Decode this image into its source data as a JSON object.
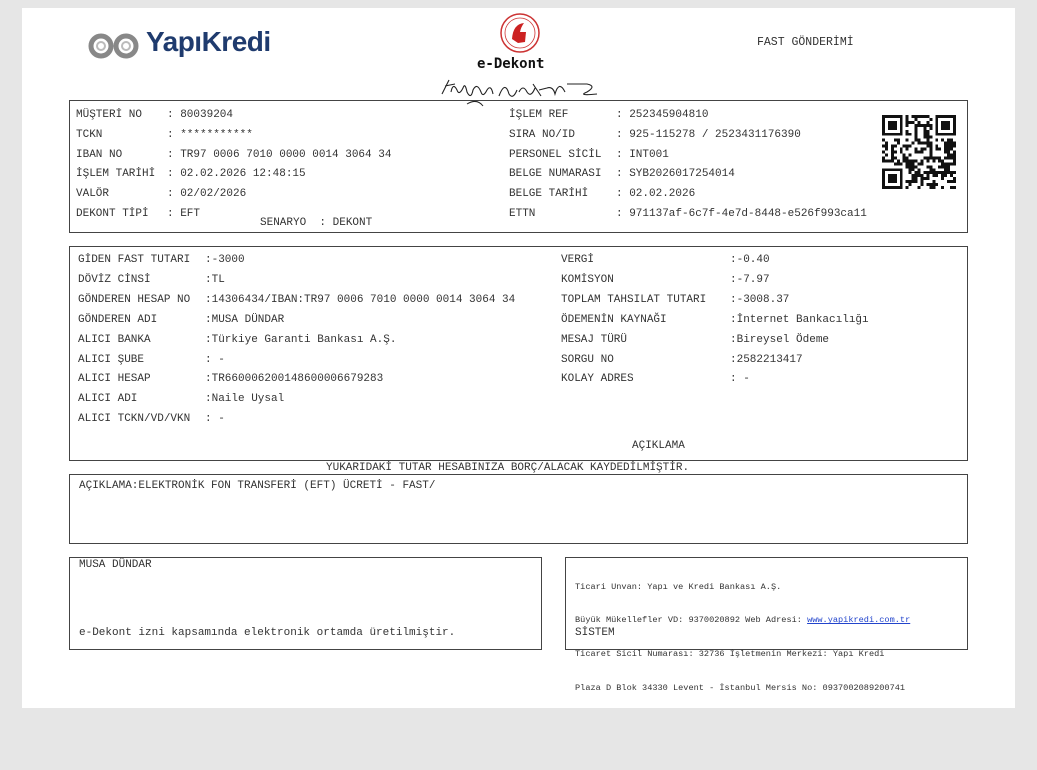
{
  "header": {
    "bank_logo": "YapıKredi",
    "doc_title": "e-Dekont",
    "transfer_type": "FAST GÖNDERİMİ"
  },
  "info_left": [
    {
      "label": "MÜŞTERİ NO",
      "value": ": 80039204"
    },
    {
      "label": "TCKN",
      "value": ": ***********"
    },
    {
      "label": "IBAN NO",
      "value": ": TR97 0006 7010 0000 0014 3064 34"
    },
    {
      "label": "İŞLEM TARİHİ",
      "value": ": 02.02.2026 12:48:15"
    },
    {
      "label": "VALÖR",
      "value": ": 02/02/2026"
    },
    {
      "label": "DEKONT TİPİ",
      "value": ": EFT"
    }
  ],
  "scenario": {
    "label": "SENARYO",
    "value": ": DEKONT"
  },
  "info_right": [
    {
      "label": "İŞLEM REF",
      "value": ": 252345904810"
    },
    {
      "label": "SIRA NO/ID",
      "value": ": 925-115278 / 2523431176390"
    },
    {
      "label": "PERSONEL SİCİL",
      "value": ": INT001"
    },
    {
      "label": "BELGE NUMARASI",
      "value": ": SYB2026017254014"
    },
    {
      "label": "BELGE TARİHİ",
      "value": ": 02.02.2026"
    },
    {
      "label": "ETTN",
      "value": ": 971137af-6c7f-4e7d-8448-e526f993ca11"
    }
  ],
  "details_left": [
    {
      "label": "GİDEN FAST TUTARI",
      "value": ":-3000"
    },
    {
      "label": "DÖVİZ CİNSİ",
      "value": ":TL"
    },
    {
      "label": "GÖNDEREN HESAP NO",
      "value": ":14306434/IBAN:TR97 0006 7010 0000 0014 3064 34"
    },
    {
      "label": "GÖNDEREN ADI",
      "value": ":MUSA DÜNDAR"
    },
    {
      "label": "ALICI BANKA",
      "value": ":Türkiye Garanti Bankası A.Ş."
    },
    {
      "label": "ALICI ŞUBE",
      "value": ": -"
    },
    {
      "label": "ALICI HESAP",
      "value": ":TR660006200148600006679283"
    },
    {
      "label": "ALICI ADI",
      "value": ":Naile Uysal"
    },
    {
      "label": "ALICI TCKN/VD/VKN",
      "value": ": -"
    }
  ],
  "details_right": [
    {
      "label": "VERGİ",
      "value": ":-0.40"
    },
    {
      "label": "KOMİSYON",
      "value": ":-7.97"
    },
    {
      "label": "TOPLAM TAHSILAT TUTARI",
      "value": ":-3008.37"
    },
    {
      "label": "ÖDEMENİN KAYNAĞI",
      "value": ":İnternet Bankacılığı"
    },
    {
      "label": "MESAJ TÜRÜ",
      "value": ":Bireysel Ödeme"
    },
    {
      "label": "SORGU NO",
      "value": ":2582213417"
    },
    {
      "label": "KOLAY ADRES",
      "value": ": -"
    }
  ],
  "aciklama_header": "AÇIKLAMA",
  "notice": "YUKARIDAKİ TUTAR HESABINIZA BORÇ/ALACAK KAYDEDİLMİŞTİR.",
  "description": "AÇIKLAMA:ELEKTRONİK FON TRANSFERİ (EFT) ÜCRETİ - FAST/",
  "customer_box": {
    "name": "MUSA DÜNDAR",
    "note": "e-Dekont izni kapsamında elektronik ortamda üretilmiştir."
  },
  "bank_box": {
    "line1": "Ticari Unvan: Yapı ve Kredi Bankası A.Ş.",
    "line2_prefix": "Büyük Mükellefler VD: 9370020892 Web Adresi: ",
    "link": "www.yapikredi.com.tr",
    "line3": "Ticaret Sicil Numarası: 32736 İşletmenin Merkezi: Yapı Kredi",
    "line4": "Plaza D Blok 34330 Levent - İstanbul Mersis No: 0937002089200741",
    "system": "SİSTEM"
  }
}
